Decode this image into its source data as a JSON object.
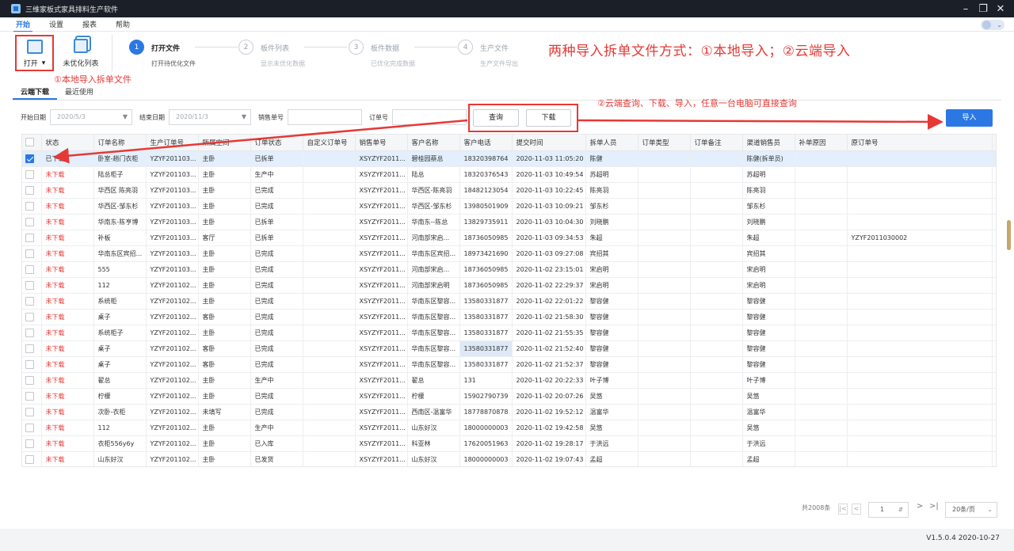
{
  "window": {
    "title": "三维家板式家具排料生产软件"
  },
  "menu": [
    {
      "label": "开始",
      "active": true
    },
    {
      "label": "设置",
      "active": false
    },
    {
      "label": "报表",
      "active": false
    },
    {
      "label": "帮助",
      "active": false
    }
  ],
  "toolbar": {
    "open_label": "打开",
    "open_dropdown": "▾",
    "unoptimized_label": "未优化列表"
  },
  "steps": [
    {
      "num": "1",
      "name": "打开文件",
      "desc": "打开待优化文件",
      "active": true
    },
    {
      "num": "2",
      "name": "板件列表",
      "desc": "显示未优化数据",
      "active": false
    },
    {
      "num": "3",
      "name": "板件数据",
      "desc": "已优化完成数据",
      "active": false
    },
    {
      "num": "4",
      "name": "生产文件",
      "desc": "生产文件导出",
      "active": false
    }
  ],
  "annotations": {
    "headline": "两种导入拆单文件方式：①本地导入；②云端导入",
    "local": "①本地导入拆单文件",
    "cloud": "②云端查询、下载、导入，任意一台电脑可直接查询"
  },
  "tabs": [
    {
      "label": "云端下载",
      "active": true
    },
    {
      "label": "最近使用",
      "active": false
    }
  ],
  "filters": {
    "start_label": "开始日期",
    "start_value": "2020/5/3",
    "end_label": "结束日期",
    "end_value": "2020/11/3",
    "sales_label": "销售单号",
    "order_label": "订单号",
    "query_button": "查询",
    "download_button": "下载",
    "import_button": "导入"
  },
  "table": {
    "columns": [
      "状态",
      "订单名称",
      "生产订单号",
      "所属空间",
      "订单状态",
      "自定义订单号",
      "销售单号",
      "客户名称",
      "客户电话",
      "提交时间",
      "拆单人员",
      "订单类型",
      "订单备注",
      "渠道销售员",
      "补单原因",
      "原订单号"
    ],
    "rows": [
      {
        "checked": true,
        "cells": [
          "已下载",
          "卧室-趟门衣柜",
          "YZYF201103...",
          "主卧",
          "已拆单",
          "",
          "XSYZYF2011...",
          "碧桂园蔡总",
          "18320398764",
          "2020-11-03 11:05:20",
          "陈健",
          "",
          "",
          "陈健(拆单员)",
          "",
          ""
        ]
      },
      {
        "checked": false,
        "cells": [
          "未下载",
          "陆总柜子",
          "YZYF201103...",
          "主卧",
          "生产中",
          "",
          "XSYZYF2011...",
          "陆总",
          "18320376543",
          "2020-11-03 10:49:54",
          "苏超明",
          "",
          "",
          "苏超明",
          "",
          ""
        ]
      },
      {
        "checked": false,
        "cells": [
          "未下载",
          "华西区 陈亮羽",
          "YZYF201103...",
          "主卧",
          "已完成",
          "",
          "XSYZYF2011...",
          "华西区-陈亮羽",
          "18482123054",
          "2020-11-03 10:22:45",
          "陈亮羽",
          "",
          "",
          "陈亮羽",
          "",
          ""
        ]
      },
      {
        "checked": false,
        "cells": [
          "未下载",
          "华西区-邹东杉",
          "YZYF201103...",
          "主卧",
          "已完成",
          "",
          "XSYZYF2011...",
          "华西区-邹东杉",
          "13980501909",
          "2020-11-03 10:09:21",
          "邹东杉",
          "",
          "",
          "邹东杉",
          "",
          ""
        ]
      },
      {
        "checked": false,
        "cells": [
          "未下载",
          "华南东-陈亨博",
          "YZYF201103...",
          "主卧",
          "已拆单",
          "",
          "XSYZYF2011...",
          "华南东--陈总",
          "13829735911",
          "2020-11-03 10:04:30",
          "刘晓鹏",
          "",
          "",
          "刘晓鹏",
          "",
          ""
        ]
      },
      {
        "checked": false,
        "cells": [
          "未下载",
          "补板",
          "YZYF201103...",
          "客厅",
          "已拆单",
          "",
          "XSYZYF2011...",
          "河南部宋启...",
          "18736050985",
          "2020-11-03 09:34:53",
          "朱超",
          "",
          "",
          "朱超",
          "",
          "YZYF2011030002"
        ]
      },
      {
        "checked": false,
        "cells": [
          "未下载",
          "华南东区宾招...",
          "YZYF201103...",
          "主卧",
          "已完成",
          "",
          "XSYZYF2011...",
          "华南东区宾招...",
          "18973421690",
          "2020-11-03 09:27:08",
          "宾招其",
          "",
          "",
          "宾招其",
          "",
          ""
        ]
      },
      {
        "checked": false,
        "cells": [
          "未下载",
          "555",
          "YZYF201103...",
          "主卧",
          "已完成",
          "",
          "XSYZYF2011...",
          "河南部宋启...",
          "18736050985",
          "2020-11-02 23:15:01",
          "宋启明",
          "",
          "",
          "宋启明",
          "",
          ""
        ]
      },
      {
        "checked": false,
        "cells": [
          "未下载",
          "112",
          "YZYF201102...",
          "主卧",
          "已完成",
          "",
          "XSYZYF2011...",
          "河南部宋启明",
          "18736050985",
          "2020-11-02 22:29:37",
          "宋启明",
          "",
          "",
          "宋启明",
          "",
          ""
        ]
      },
      {
        "checked": false,
        "cells": [
          "未下载",
          "系统柜",
          "YZYF201102...",
          "主卧",
          "已完成",
          "",
          "XSYZYF2011...",
          "华南东区黎容...",
          "13580331877",
          "2020-11-02 22:01:22",
          "黎容健",
          "",
          "",
          "黎容健",
          "",
          ""
        ]
      },
      {
        "checked": false,
        "cells": [
          "未下载",
          "桌子",
          "YZYF201102...",
          "客卧",
          "已完成",
          "",
          "XSYZYF2011...",
          "华南东区黎容...",
          "13580331877",
          "2020-11-02 21:58:30",
          "黎容健",
          "",
          "",
          "黎容健",
          "",
          ""
        ]
      },
      {
        "checked": false,
        "cells": [
          "未下载",
          "系统柜子",
          "YZYF201102...",
          "主卧",
          "已完成",
          "",
          "XSYZYF2011...",
          "华南东区黎容...",
          "13580331877",
          "2020-11-02 21:55:35",
          "黎容健",
          "",
          "",
          "黎容健",
          "",
          ""
        ]
      },
      {
        "checked": false,
        "cells": [
          "未下载",
          "桌子",
          "YZYF201102...",
          "客卧",
          "已完成",
          "",
          "XSYZYF2011...",
          "华南东区黎容...",
          "13580331877",
          "2020-11-02 21:52:40",
          "黎容健",
          "",
          "",
          "黎容健",
          "",
          ""
        ]
      },
      {
        "checked": false,
        "cells": [
          "未下载",
          "桌子",
          "YZYF201102...",
          "客卧",
          "已完成",
          "",
          "XSYZYF2011...",
          "华南东区黎容...",
          "13580331877",
          "2020-11-02 21:52:37",
          "黎容健",
          "",
          "",
          "黎容健",
          "",
          ""
        ]
      },
      {
        "checked": false,
        "cells": [
          "未下载",
          "翟总",
          "YZYF201102...",
          "主卧",
          "生产中",
          "",
          "XSYZYF2011...",
          "翟总",
          "131",
          "2020-11-02 20:22:33",
          "叶子博",
          "",
          "",
          "叶子博",
          "",
          ""
        ]
      },
      {
        "checked": false,
        "cells": [
          "未下载",
          "柠檬",
          "YZYF201102...",
          "主卧",
          "已完成",
          "",
          "XSYZYF2011...",
          "柠檬",
          "15902790739",
          "2020-11-02 20:07:26",
          "吴悠",
          "",
          "",
          "吴悠",
          "",
          ""
        ]
      },
      {
        "checked": false,
        "cells": [
          "未下载",
          "次卧-衣柜",
          "YZYF201102...",
          "未填写",
          "已完成",
          "",
          "XSYZYF2011...",
          "西南区-温富华",
          "18778870878",
          "2020-11-02 19:52:12",
          "温富华",
          "",
          "",
          "温富华",
          "",
          ""
        ]
      },
      {
        "checked": false,
        "cells": [
          "未下载",
          "112",
          "YZYF201102...",
          "主卧",
          "生产中",
          "",
          "XSYZYF2011...",
          "山东好汉",
          "18000000003",
          "2020-11-02 19:42:58",
          "吴悠",
          "",
          "",
          "吴悠",
          "",
          ""
        ]
      },
      {
        "checked": false,
        "cells": [
          "未下载",
          "衣柜556y6y",
          "YZYF201102...",
          "主卧",
          "已入库",
          "",
          "XSYZYF2011...",
          "科亚林",
          "17620051963",
          "2020-11-02 19:28:17",
          "于洪远",
          "",
          "",
          "于洪远",
          "",
          ""
        ]
      },
      {
        "checked": false,
        "cells": [
          "未下载",
          "山东好汉",
          "YZYF201102...",
          "主卧",
          "已发货",
          "",
          "XSYZYF2011...",
          "山东好汉",
          "18000000003",
          "2020-11-02 19:07:43",
          "孟超",
          "",
          "",
          "孟超",
          "",
          ""
        ]
      }
    ]
  },
  "pagination": {
    "total": "共2008条",
    "page": "1",
    "page_size": "20条/页"
  },
  "version": "V1.5.0.4 2020-10-27",
  "colors": {
    "accent": "#2b78e4",
    "annotation": "#e53935"
  }
}
